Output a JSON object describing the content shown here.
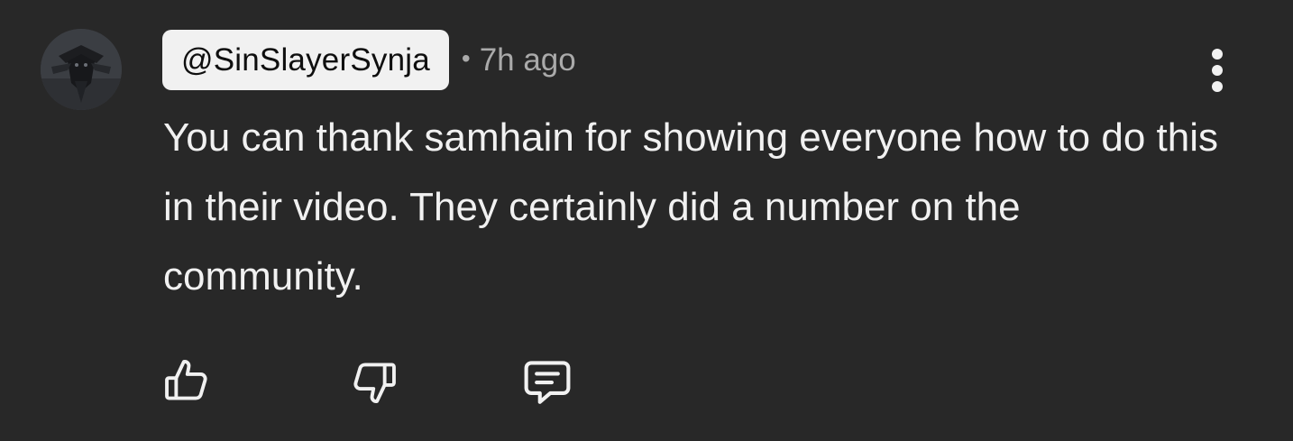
{
  "comment": {
    "author_handle": "@SinSlayerSynja",
    "separator": "•",
    "timestamp": "7h ago",
    "text": "You can thank samhain for showing everyone how to do this in their video. They certainly did a number on the community."
  },
  "icons": {
    "avatar": "user-avatar",
    "more": "more-vertical-icon",
    "like": "thumbs-up-icon",
    "dislike": "thumbs-down-icon",
    "reply": "comment-reply-icon"
  },
  "colors": {
    "background": "#282828",
    "text": "#f1f1f1",
    "secondary_text": "#aaaaaa",
    "handle_chip_bg": "#f1f1f1"
  }
}
